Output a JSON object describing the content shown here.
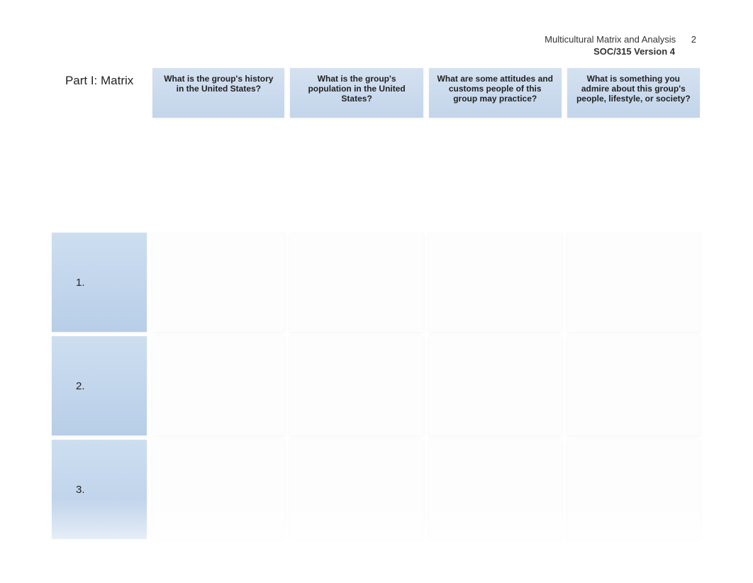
{
  "header": {
    "title": "Multicultural Matrix and Analysis",
    "page_number": "2",
    "version": "SOC/315 Version 4"
  },
  "matrix": {
    "part_label": "Part I: Matrix",
    "columns": [
      "What is the group's history in the United States?",
      "What is the group's population in the United States?",
      "What are some attitudes and customs people of this group may practice?",
      "What is something you admire about this group's people, lifestyle, or society?"
    ],
    "rows": [
      {
        "label": "1."
      },
      {
        "label": "2."
      },
      {
        "label": "3."
      }
    ]
  }
}
